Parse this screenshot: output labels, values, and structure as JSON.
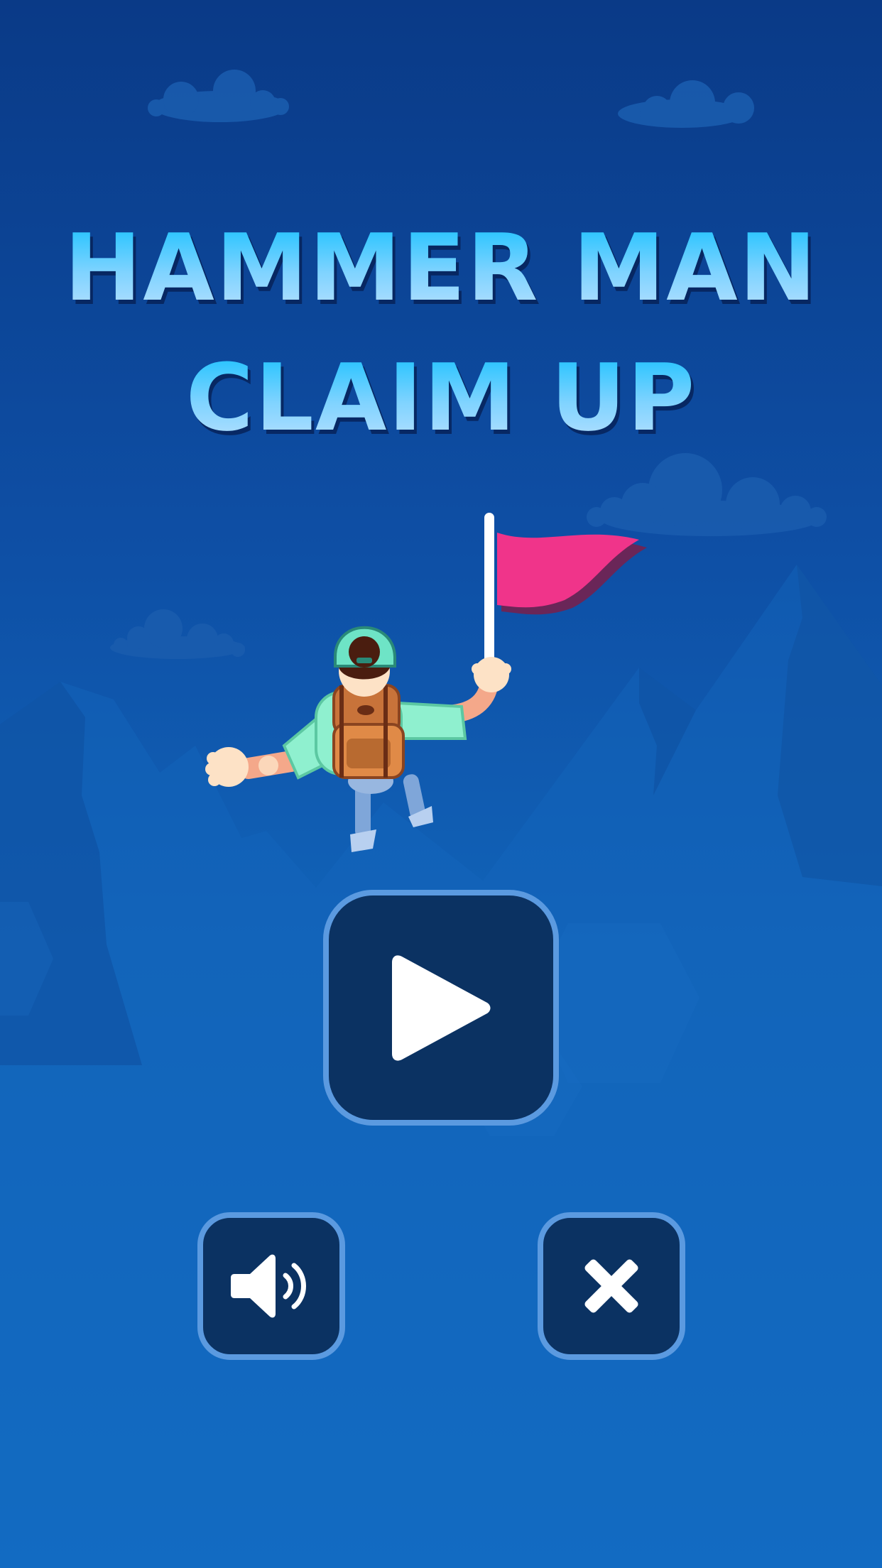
{
  "game": {
    "title_line_1": "HAMMER MAN",
    "title_line_2": "CLAIM UP"
  },
  "controls": {
    "play_icon": "play-icon",
    "sound_icon": "speaker-volume-icon",
    "close_icon": "close-x-icon"
  },
  "colors": {
    "background_top": "#0a3a87",
    "background_bottom": "#126fc6",
    "button_fill": "#0b3262",
    "button_border": "#5b9ae0",
    "flag": "#f0348a",
    "title": "#4fc3ff"
  }
}
